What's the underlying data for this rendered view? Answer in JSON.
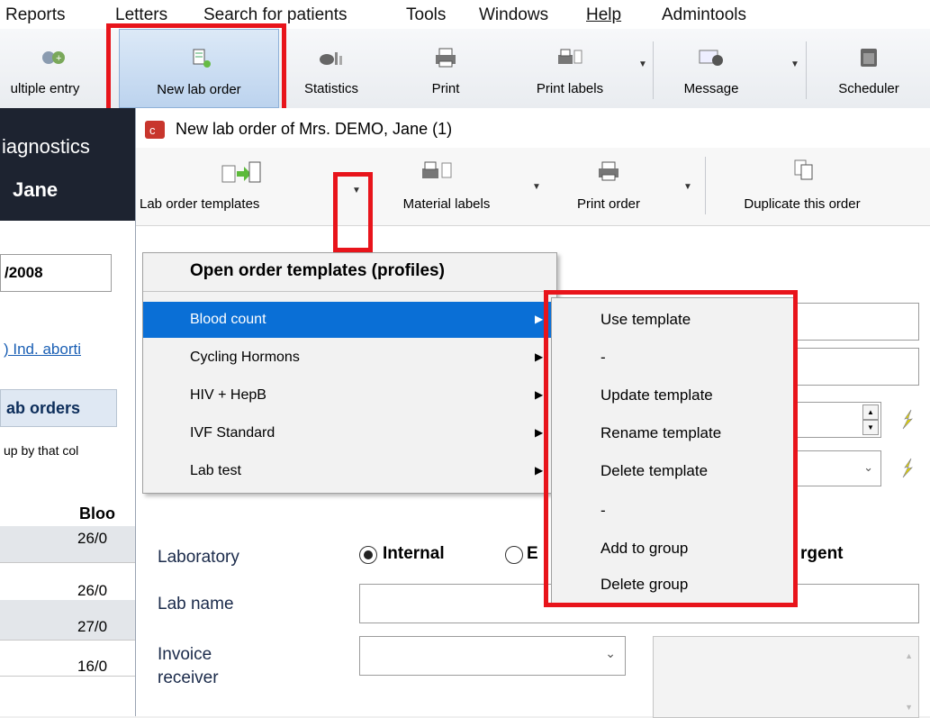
{
  "menubar": {
    "items": [
      "Reports",
      "Letters",
      "Search for patients",
      "Tools",
      "Windows",
      "Help",
      "Admintools"
    ]
  },
  "toolbar": {
    "buttons": [
      "ultiple entry",
      "New lab order",
      "Statistics",
      "Print",
      "Print labels",
      "Message",
      "Scheduler"
    ]
  },
  "background_window": {
    "title_fragment": "iagnostics",
    "patient_fragment": "Jane",
    "date_fragment": "/2008",
    "link_fragment": ") Ind. aborti",
    "tab_fragment": "ab orders",
    "group_hint": "up by that col",
    "column_header": "Bloo",
    "rows": [
      "26/0",
      "26/0",
      "27/0",
      "16/0"
    ]
  },
  "dialog": {
    "title": "New lab order of Mrs. DEMO, Jane (1)",
    "toolbar": {
      "templates": "Lab order templates",
      "material_labels": "Material labels",
      "print_order": "Print order",
      "duplicate": "Duplicate this order"
    },
    "form": {
      "laboratory_label": "Laboratory",
      "internal_label": "Internal",
      "external_fragment": "E",
      "urgent_fragment": "rgent",
      "lab_name_label": "Lab name",
      "invoice_label_line1": "Invoice",
      "invoice_label_line2": "receiver"
    }
  },
  "dropdown": {
    "header": "Open order templates (profiles)",
    "items": [
      "Blood count",
      "Cycling Hormons",
      "HIV + HepB",
      "IVF Standard",
      "Lab test"
    ],
    "selected_index": 0
  },
  "submenu": {
    "items": [
      "Use template",
      "-",
      "Update template",
      "Rename template",
      "Delete template",
      "-",
      "Add to group",
      "Delete group"
    ]
  },
  "colors": {
    "highlight": "#0a6fd6",
    "annotation_red": "#e8141b",
    "dark_header": "#1d2330",
    "lightning": "#e3d400"
  }
}
